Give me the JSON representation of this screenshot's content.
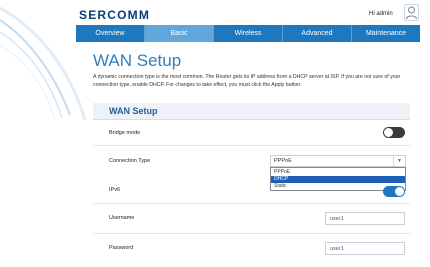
{
  "header": {
    "logo": "SERCOMM",
    "user_label": "Hi admin"
  },
  "nav": {
    "tabs": [
      {
        "label": "Overview"
      },
      {
        "label": "Basic"
      },
      {
        "label": "Wireless"
      },
      {
        "label": "Advanced"
      },
      {
        "label": "Maintenance"
      }
    ],
    "active_tab": "Basic"
  },
  "page": {
    "title": "WAN Setup",
    "description": "A dynamic connection type is the most common. The Router gets its IP address from a DHCP server at ISP. If you are not sure of your connection type, enable DHCP. For changes to take effect, you must click the Apply button."
  },
  "panel": {
    "title": "WAN Setup",
    "bridge_mode": {
      "label": "Bridge mode",
      "enabled": false
    },
    "connection_type": {
      "label": "Connection Type",
      "selected": "PPPoE",
      "options": [
        "PPPoE",
        "DHCP",
        "Static"
      ],
      "highlighted": "DHCP"
    },
    "ipv6": {
      "label": "IPv6",
      "enabled": true
    },
    "username": {
      "label": "Username",
      "value": "user1"
    },
    "password": {
      "label": "Password",
      "value": "user1"
    }
  },
  "colors": {
    "nav_bg": "#1f78bd",
    "nav_active": "#62a7dc",
    "title_blue": "#2f7fbf",
    "highlight": "#1f5fb8"
  }
}
